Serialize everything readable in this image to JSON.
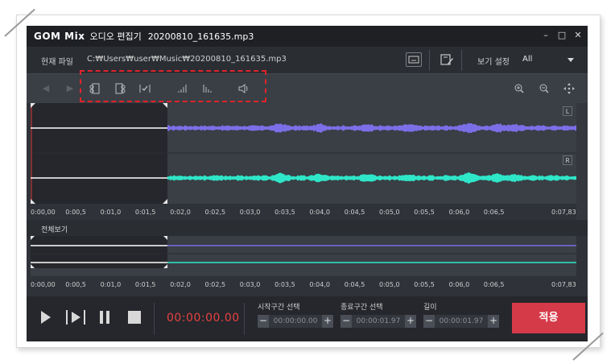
{
  "window": {
    "logo": "GOM Mix",
    "app_title": "오디오 편집기",
    "file_title": "20200810_161635.mp3",
    "minimize": "–",
    "maximize": "□",
    "close": "✕"
  },
  "infobar": {
    "current_file_label": "현재 파일",
    "path": "C:₩Users₩user₩Music₩20200810_161635.mp3",
    "view_label": "보기 설정",
    "view_value": "All"
  },
  "toolbar": {
    "icons": [
      "arrow-left-icon",
      "arrow-right-icon",
      "cut-icon",
      "trim-icon",
      "select-check-icon",
      "fade-in-icon",
      "fade-out-icon",
      "volume-icon",
      "zoom-in-icon",
      "zoom-out-icon",
      "fit-icon"
    ]
  },
  "waveform": {
    "channel_left": "L",
    "channel_right": "R",
    "colors": {
      "left": "#7b6fe8",
      "right": "#2ee6c8",
      "selection": "#25272c"
    }
  },
  "ruler": {
    "ticks": [
      "0:00,00",
      "0:00,5",
      "0:01,0",
      "0:01,5",
      "0:02,0",
      "0:02,5",
      "0:03,0",
      "0:03,5",
      "0:04,0",
      "0:04,5",
      "0:05,0",
      "0:05,5",
      "0:06,0",
      "0:06,5",
      "0:07,83"
    ]
  },
  "overview": {
    "label": "전체보기"
  },
  "controls": {
    "time": "00:00:00.00",
    "start_label": "시작구간 선택",
    "start_value": "00:00:00.00",
    "end_label": "종료구간 선택",
    "end_value": "00:00:01.97",
    "length_label": "길이",
    "length_value": "00:00:01.97",
    "minus": "−",
    "plus": "+",
    "apply_label": "적용"
  }
}
